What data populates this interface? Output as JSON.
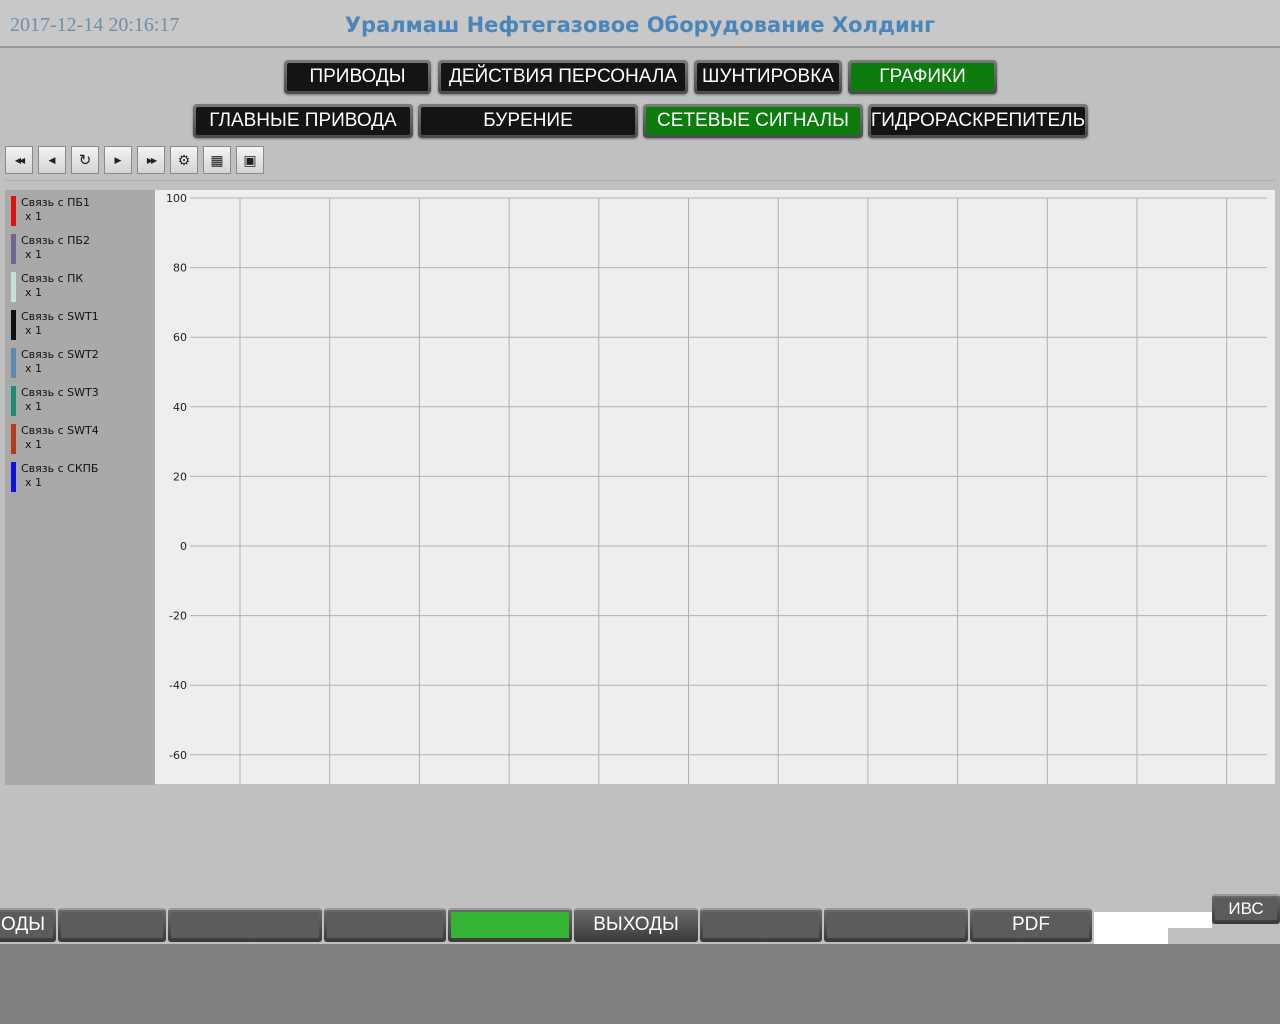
{
  "header": {
    "timestamp": "2017-12-14 20:16:17",
    "title": "Уралмаш Нефтегазовое Оборудование Холдинг"
  },
  "nav_row1": [
    {
      "label": "ПРИВОДЫ",
      "active": false
    },
    {
      "label": "ДЕЙСТВИЯ ПЕРСОНАЛА",
      "active": false
    },
    {
      "label": "ШУНТИРОВКА",
      "active": false
    },
    {
      "label": "ГРАФИКИ",
      "active": true
    }
  ],
  "nav_row2": [
    {
      "label": "ГЛАВНЫЕ ПРИВОДА",
      "active": false
    },
    {
      "label": "БУРЕНИЕ",
      "active": false
    },
    {
      "label": "СЕТЕВЫЕ СИГНАЛЫ",
      "active": true
    },
    {
      "label": "ГИДРОРАСКРЕПИТЕЛЬ",
      "active": false
    }
  ],
  "toolbar": [
    {
      "icon": "rewind-icon",
      "glyph": "◀◀"
    },
    {
      "icon": "step-back-icon",
      "glyph": "◀"
    },
    {
      "icon": "refresh-icon",
      "glyph": "↻"
    },
    {
      "icon": "step-forward-icon",
      "glyph": "▶"
    },
    {
      "icon": "fast-forward-icon",
      "glyph": "▶▶"
    },
    {
      "icon": "settings-icon",
      "glyph": "⚙"
    },
    {
      "icon": "calendar-icon",
      "glyph": "▦"
    },
    {
      "icon": "save-icon",
      "glyph": "▣"
    }
  ],
  "legend": [
    {
      "name": "Связь с ПБ1",
      "scale": "x 1",
      "color": "#e01010"
    },
    {
      "name": "Связь с ПБ2",
      "scale": "x 1",
      "color": "#6e6690"
    },
    {
      "name": "Связь с ПК",
      "scale": "x 1",
      "color": "#c8e0dc"
    },
    {
      "name": "Связь с SWT1",
      "scale": "x 1",
      "color": "#101010"
    },
    {
      "name": "Связь с SWT2",
      "scale": "x 1",
      "color": "#5a8ab0"
    },
    {
      "name": "Связь с SWT3",
      "scale": "x 1",
      "color": "#1a8a70"
    },
    {
      "name": "Связь с SWT4",
      "scale": "x 1",
      "color": "#b83a1a"
    },
    {
      "name": "Связь с СКПБ",
      "scale": "x 1",
      "color": "#1010e0"
    }
  ],
  "chart_data": {
    "type": "line",
    "yticks": [
      100,
      80,
      60,
      40,
      20,
      0,
      -20,
      -40,
      -60
    ],
    "ylim": [
      -68,
      100
    ],
    "grid": true,
    "vertical_gridlines": 12,
    "series": [
      {
        "name": "Связь с ПБ1",
        "values": []
      },
      {
        "name": "Связь с ПБ2",
        "values": []
      },
      {
        "name": "Связь с ПК",
        "values": []
      },
      {
        "name": "Связь с SWT1",
        "values": []
      },
      {
        "name": "Связь с SWT2",
        "values": []
      },
      {
        "name": "Связь с SWT3",
        "values": []
      },
      {
        "name": "Связь с SWT4",
        "values": []
      },
      {
        "name": "Связь с СКПБ",
        "values": []
      }
    ]
  },
  "bottom_bar": [
    {
      "label": "ОДЫ",
      "green": false
    },
    {
      "label": "",
      "green": false
    },
    {
      "label": "",
      "green": false
    },
    {
      "label": "",
      "green": false
    },
    {
      "label": "",
      "green": true
    },
    {
      "label": "ВЫХОДЫ",
      "green": false
    },
    {
      "label": "",
      "green": false
    },
    {
      "label": "",
      "green": false
    },
    {
      "label": "PDF",
      "green": false
    },
    {
      "label": "ИВС",
      "green": false
    }
  ]
}
